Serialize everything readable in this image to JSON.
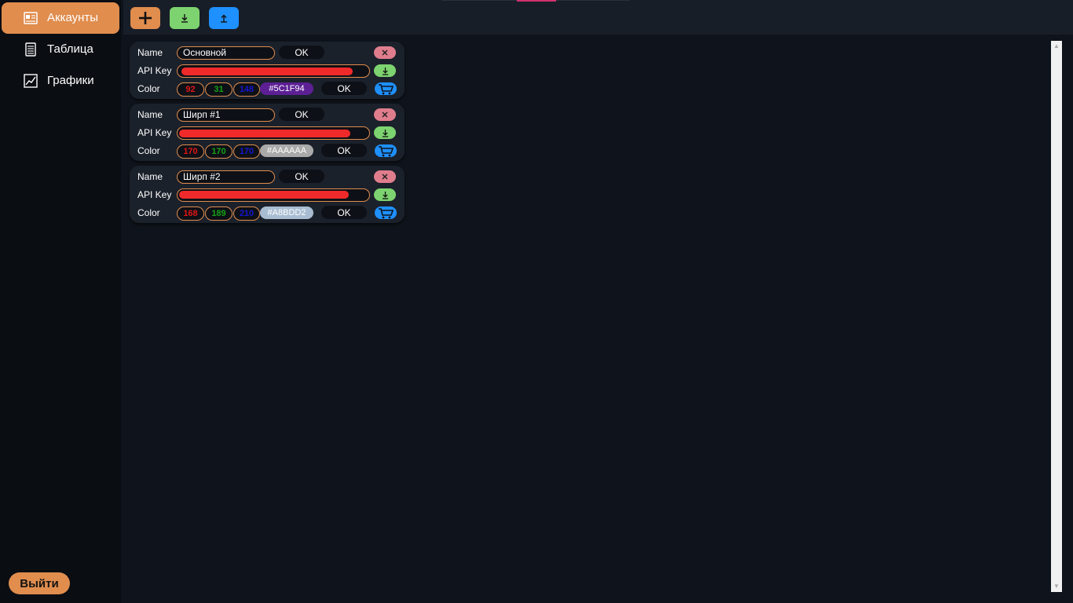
{
  "sidebar": {
    "items": [
      {
        "label": "Аккаунты",
        "icon": "accounts-icon",
        "active": true
      },
      {
        "label": "Таблица",
        "icon": "table-icon",
        "active": false
      },
      {
        "label": "Графики",
        "icon": "chart-icon",
        "active": false
      }
    ],
    "logout_label": "Выйти"
  },
  "toolbar": {
    "add_icon": "plus-icon",
    "import_icon": "download-icon",
    "export_icon": "upload-icon"
  },
  "labels": {
    "name": "Name",
    "api_key": "API Key",
    "color": "Color",
    "ok": "OK",
    "close": "✕"
  },
  "accounts": [
    {
      "name": "Основной",
      "r": "92",
      "g": "31",
      "b": "148",
      "hex": "#5C1F94",
      "hex_color": "#5c1f94"
    },
    {
      "name": "Ширп #1",
      "r": "170",
      "g": "170",
      "b": "170",
      "hex": "#AAAAAA",
      "hex_color": "#aaaaaa"
    },
    {
      "name": "Ширп #2",
      "r": "168",
      "g": "189",
      "b": "210",
      "hex": "#A8BDD2",
      "hex_color": "#a8bdd2"
    }
  ],
  "colors": {
    "accent": "#e08d4e",
    "green": "#7dd36f",
    "blue": "#1e90ff",
    "red": "#e07d8d",
    "redaction": "#f02a2a"
  }
}
